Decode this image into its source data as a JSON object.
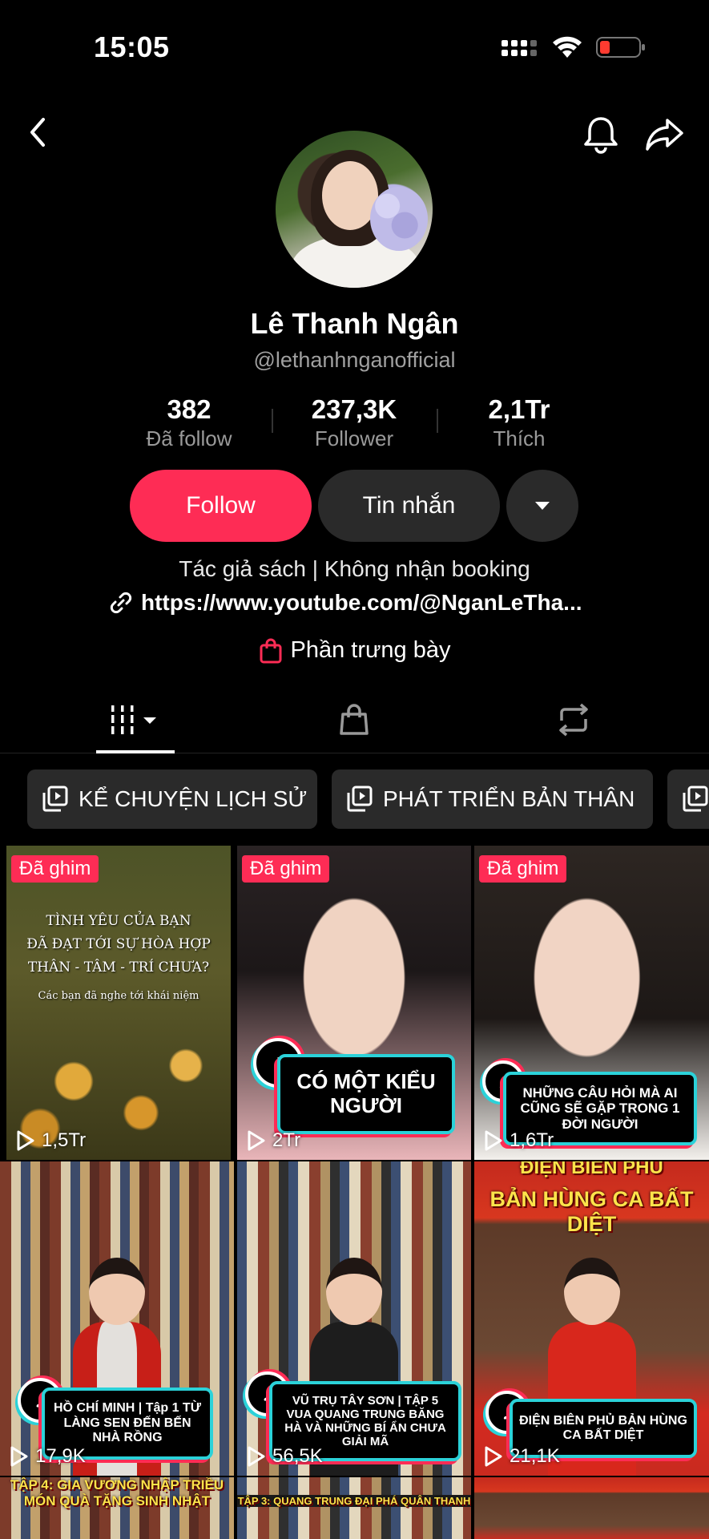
{
  "status_bar": {
    "time": "15:05"
  },
  "profile": {
    "name": "Lê Thanh Ngân",
    "handle": "@lethanhnganofficial",
    "stats": [
      {
        "value": "382",
        "label": "Đã follow"
      },
      {
        "value": "237,3K",
        "label": "Follower"
      },
      {
        "value": "2,1Tr",
        "label": "Thích"
      }
    ],
    "follow_label": "Follow",
    "message_label": "Tin nhắn",
    "bio": "Tác giả sách | Không nhận booking",
    "link": "https://www.youtube.com/@NganLeTha...",
    "showcase": "Phần trưng bày"
  },
  "playlists": [
    {
      "label": "KỂ CHUYỆN LỊCH SỬ"
    },
    {
      "label": "PHÁT TRIỂN BẢN THÂN"
    }
  ],
  "videos": [
    {
      "pinned": "Đã ghim",
      "views": "1,5Tr",
      "overlay": [
        "TÌNH YÊU CỦA BẠN",
        "ĐÃ ĐẠT TỚI SỰ HÒA HỢP",
        "THÂN - TÂM - TRÍ CHƯA?"
      ],
      "sub": "Các bạn đã nghe tới khái niệm"
    },
    {
      "pinned": "Đã ghim",
      "views": "2Tr",
      "caption": "CÓ MỘT KIỂU NGƯỜI"
    },
    {
      "pinned": "Đã ghim",
      "views": "1,6Tr",
      "caption": "NHỮNG CÂU HỎI MÀ AI CŨNG SẼ GẶP TRONG 1 ĐỜI NGƯỜI"
    },
    {
      "views": "17,9K",
      "caption": "HỒ CHÍ MINH | Tập 1 TỪ LÀNG SEN ĐẾN BẾN NHÀ RỒNG"
    },
    {
      "views": "56,5K",
      "caption": "VŨ TRỤ TÂY SƠN | TẬP 5 VUA QUANG TRUNG BĂNG HÀ VÀ NHỮNG BÍ ẨN CHƯA GIẢI MÃ"
    },
    {
      "views": "21,1K",
      "headline": "BẢN HÙNG CA BẤT DIỆT",
      "headline_top": "ĐIỆN BIÊN PHỦ",
      "caption": "ĐIỆN BIÊN PHỦ BẢN HÙNG CA BẤT DIỆT"
    },
    {
      "strip": "TẬP 4: GIA VƯƠNG NHẬP TRIỀU MÓN QUÀ TẶNG SINH NHẬT"
    },
    {
      "strip": "TẬP 3: QUANG TRUNG ĐẠI PHÁ QUÂN THANH"
    },
    {
      "strip": ""
    }
  ],
  "colors": {
    "accent": "#fe2c55",
    "teal": "#2bd2d9",
    "chip_bg": "#2a2a2a"
  }
}
